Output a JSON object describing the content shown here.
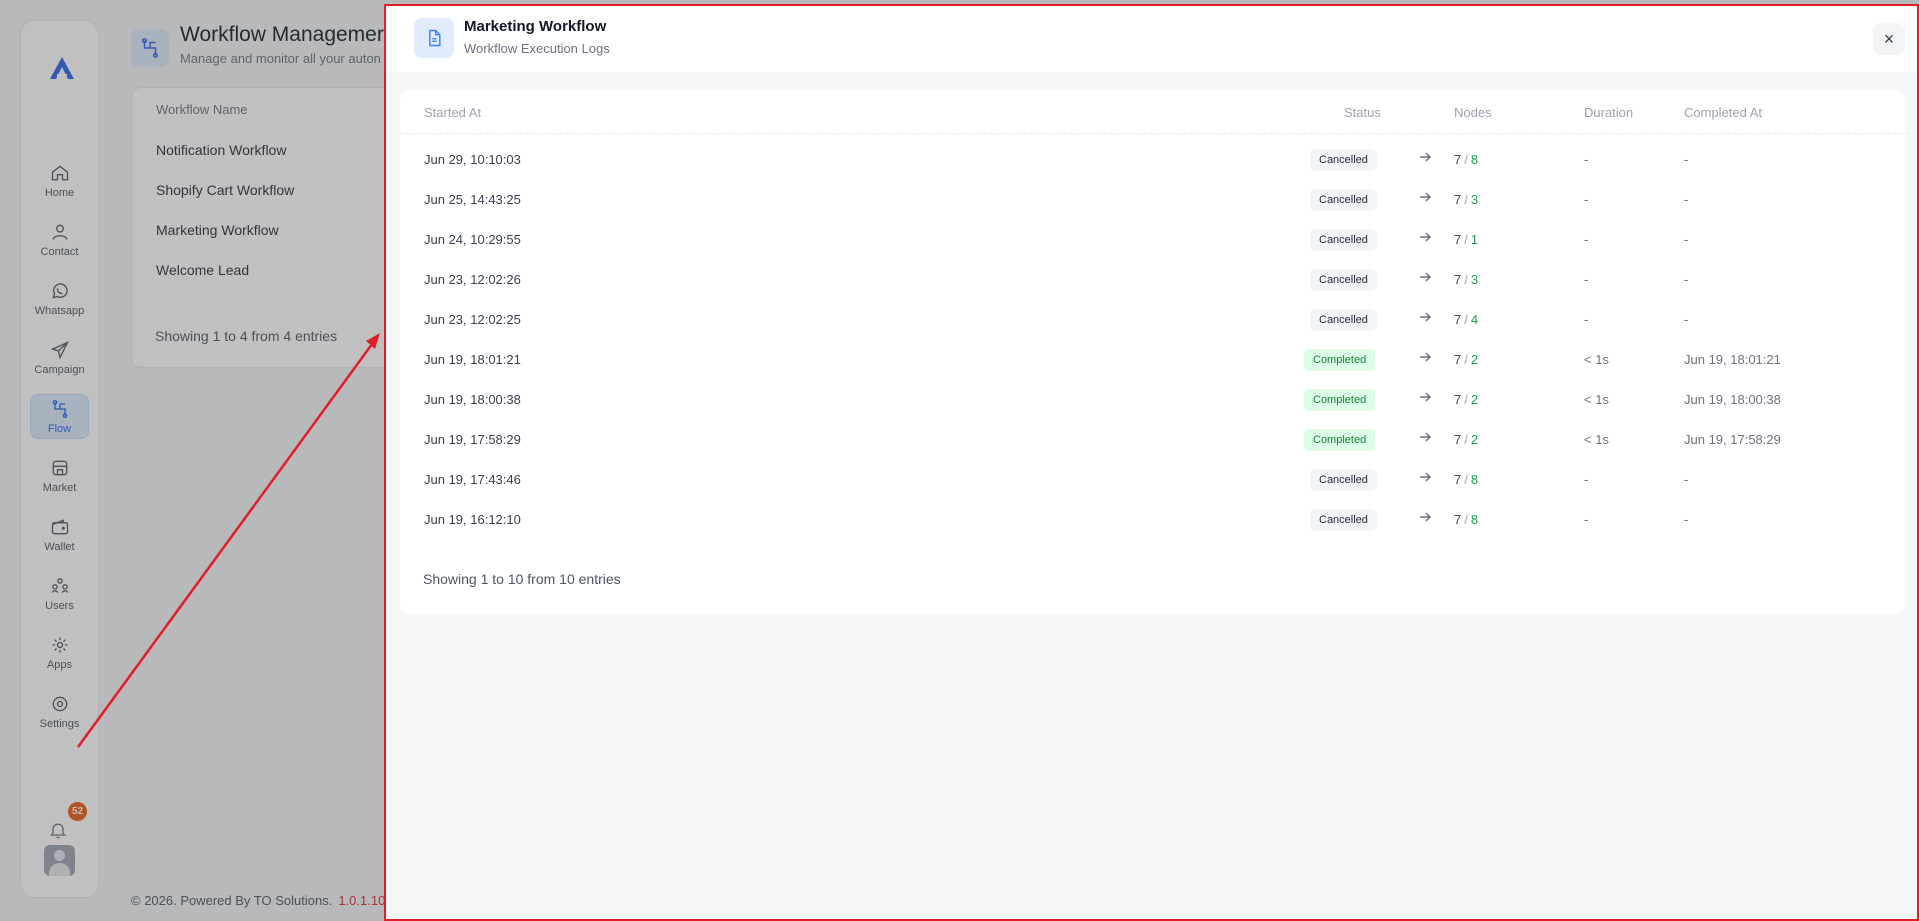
{
  "sidebar": {
    "items": [
      {
        "label": "Home",
        "icon": "home-icon"
      },
      {
        "label": "Contact",
        "icon": "user-icon"
      },
      {
        "label": "Whatsapp",
        "icon": "whatsapp-icon"
      },
      {
        "label": "Campaign",
        "icon": "send-icon"
      },
      {
        "label": "Flow",
        "icon": "flow-icon",
        "active": true
      },
      {
        "label": "Market",
        "icon": "store-icon"
      },
      {
        "label": "Wallet",
        "icon": "wallet-icon"
      },
      {
        "label": "Users",
        "icon": "users-icon"
      },
      {
        "label": "Apps",
        "icon": "apps-icon"
      },
      {
        "label": "Settings",
        "icon": "settings-icon"
      }
    ],
    "notification_count": "52"
  },
  "background_page": {
    "title": "Workflow Managemer",
    "subtitle": "Manage and monitor all your auton",
    "column_header": "Workflow Name",
    "workflows": [
      "Notification Workflow",
      "Shopify Cart Workflow",
      "Marketing Workflow",
      "Welcome Lead"
    ],
    "showing": "Showing 1 to 4 from 4 entries"
  },
  "footer": {
    "text": "© 2026. Powered By TO Solutions.",
    "version": "1.0.1.10"
  },
  "modal": {
    "title": "Marketing Workflow",
    "subtitle": "Workflow Execution Logs",
    "close_label": "×",
    "columns": {
      "started_at": "Started At",
      "status": "Status",
      "nodes": "Nodes",
      "duration": "Duration",
      "completed_at": "Completed At"
    },
    "rows": [
      {
        "started_at": "Jun 29, 10:10:03",
        "status": "Cancelled",
        "nodes_total": "7",
        "nodes_done": "8",
        "duration": "-",
        "completed_at": "-"
      },
      {
        "started_at": "Jun 25, 14:43:25",
        "status": "Cancelled",
        "nodes_total": "7",
        "nodes_done": "3",
        "duration": "-",
        "completed_at": "-"
      },
      {
        "started_at": "Jun 24, 10:29:55",
        "status": "Cancelled",
        "nodes_total": "7",
        "nodes_done": "1",
        "duration": "-",
        "completed_at": "-"
      },
      {
        "started_at": "Jun 23, 12:02:26",
        "status": "Cancelled",
        "nodes_total": "7",
        "nodes_done": "3",
        "duration": "-",
        "completed_at": "-"
      },
      {
        "started_at": "Jun 23, 12:02:25",
        "status": "Cancelled",
        "nodes_total": "7",
        "nodes_done": "4",
        "duration": "-",
        "completed_at": "-"
      },
      {
        "started_at": "Jun 19, 18:01:21",
        "status": "Completed",
        "nodes_total": "7",
        "nodes_done": "2",
        "duration": "< 1s",
        "completed_at": "Jun 19, 18:01:21"
      },
      {
        "started_at": "Jun 19, 18:00:38",
        "status": "Completed",
        "nodes_total": "7",
        "nodes_done": "2",
        "duration": "< 1s",
        "completed_at": "Jun 19, 18:00:38"
      },
      {
        "started_at": "Jun 19, 17:58:29",
        "status": "Completed",
        "nodes_total": "7",
        "nodes_done": "2",
        "duration": "< 1s",
        "completed_at": "Jun 19, 17:58:29"
      },
      {
        "started_at": "Jun 19, 17:43:46",
        "status": "Cancelled",
        "nodes_total": "7",
        "nodes_done": "8",
        "duration": "-",
        "completed_at": "-"
      },
      {
        "started_at": "Jun 19, 16:12:10",
        "status": "Cancelled",
        "nodes_total": "7",
        "nodes_done": "8",
        "duration": "-",
        "completed_at": "-"
      }
    ],
    "showing": "Showing 1 to 10 from 10 entries",
    "colors": {
      "highlight_border": "#e11d2a",
      "completed": "#16a34a",
      "accent": "#2563eb"
    }
  }
}
